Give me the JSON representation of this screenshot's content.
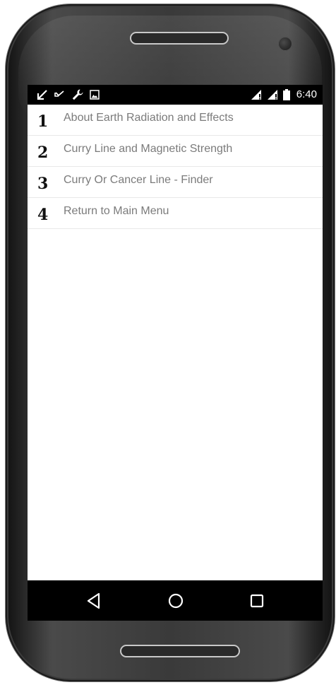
{
  "status_bar": {
    "time": "6:40",
    "left_icons": [
      "arrow-down-left-icon",
      "missed-call-icon",
      "wrench-icon",
      "image-icon"
    ],
    "right_icons": [
      "signal-icon",
      "signal-icon",
      "battery-icon"
    ]
  },
  "menu": {
    "items": [
      {
        "number": "1",
        "label": "About Earth Radiation and Effects"
      },
      {
        "number": "2",
        "label": "Curry Line and Magnetic Strength"
      },
      {
        "number": "3",
        "label": "Curry Or Cancer Line - Finder"
      },
      {
        "number": "4",
        "label": "Return to Main Menu"
      }
    ]
  },
  "nav_bar": {
    "buttons": [
      "back-icon",
      "home-icon",
      "recents-icon"
    ]
  },
  "colors": {
    "status_bar_bg": "#000000",
    "nav_bar_bg": "#000000",
    "menu_text": "#7b7b7b",
    "number_text": "#111111",
    "divider": "#e8e8e8"
  }
}
